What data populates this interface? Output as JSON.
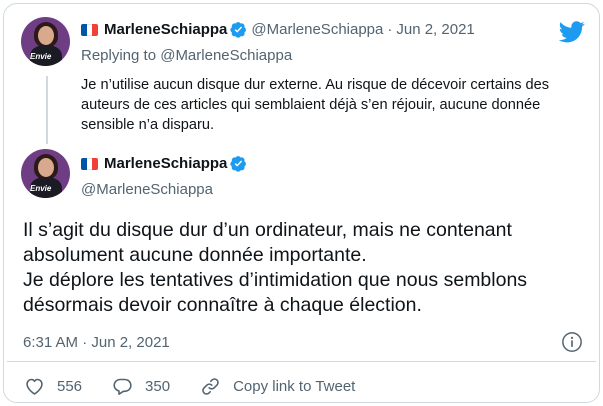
{
  "quoted_tweet": {
    "flag_colors": [
      "#0055a4",
      "#ffffff",
      "#ef4135"
    ],
    "display_name": "MarleneSchiappa",
    "handle": "@MarleneSchiappa",
    "separator": "·",
    "date": "Jun 2, 2021",
    "replying_to": "Replying to @MarleneSchiappa",
    "text": "Je n’utilise aucun disque dur externe. Au risque de décevoir certains des auteurs de ces articles qui semblaient déjà s’en réjouir, aucune donnée sensible n’a disparu.",
    "avatar_label": "Envie"
  },
  "main_tweet": {
    "display_name": "MarleneSchiappa",
    "handle": "@MarleneSchiappa",
    "avatar_label": "Envie",
    "text_line1": "Il s’agit du disque dur d’un ordinateur, mais ne contenant absolument aucune donnée importante.",
    "text_line2": "Je déplore les tentatives d’intimidation que nous semblons désormais devoir connaître à chaque élection.",
    "timestamp": "6:31 AM · Jun 2, 2021"
  },
  "actions": {
    "likes": "556",
    "replies": "350",
    "copy_link": "Copy link to Tweet"
  },
  "colors": {
    "twitter_blue": "#1d9bf0",
    "verified": "#1d9bf0",
    "like": "#e0245e"
  },
  "icons": {
    "logo": "twitter-bird-icon",
    "verified": "verified-badge-icon",
    "info": "info-icon",
    "like": "heart-icon",
    "reply": "reply-bubble-icon",
    "link": "link-icon"
  }
}
